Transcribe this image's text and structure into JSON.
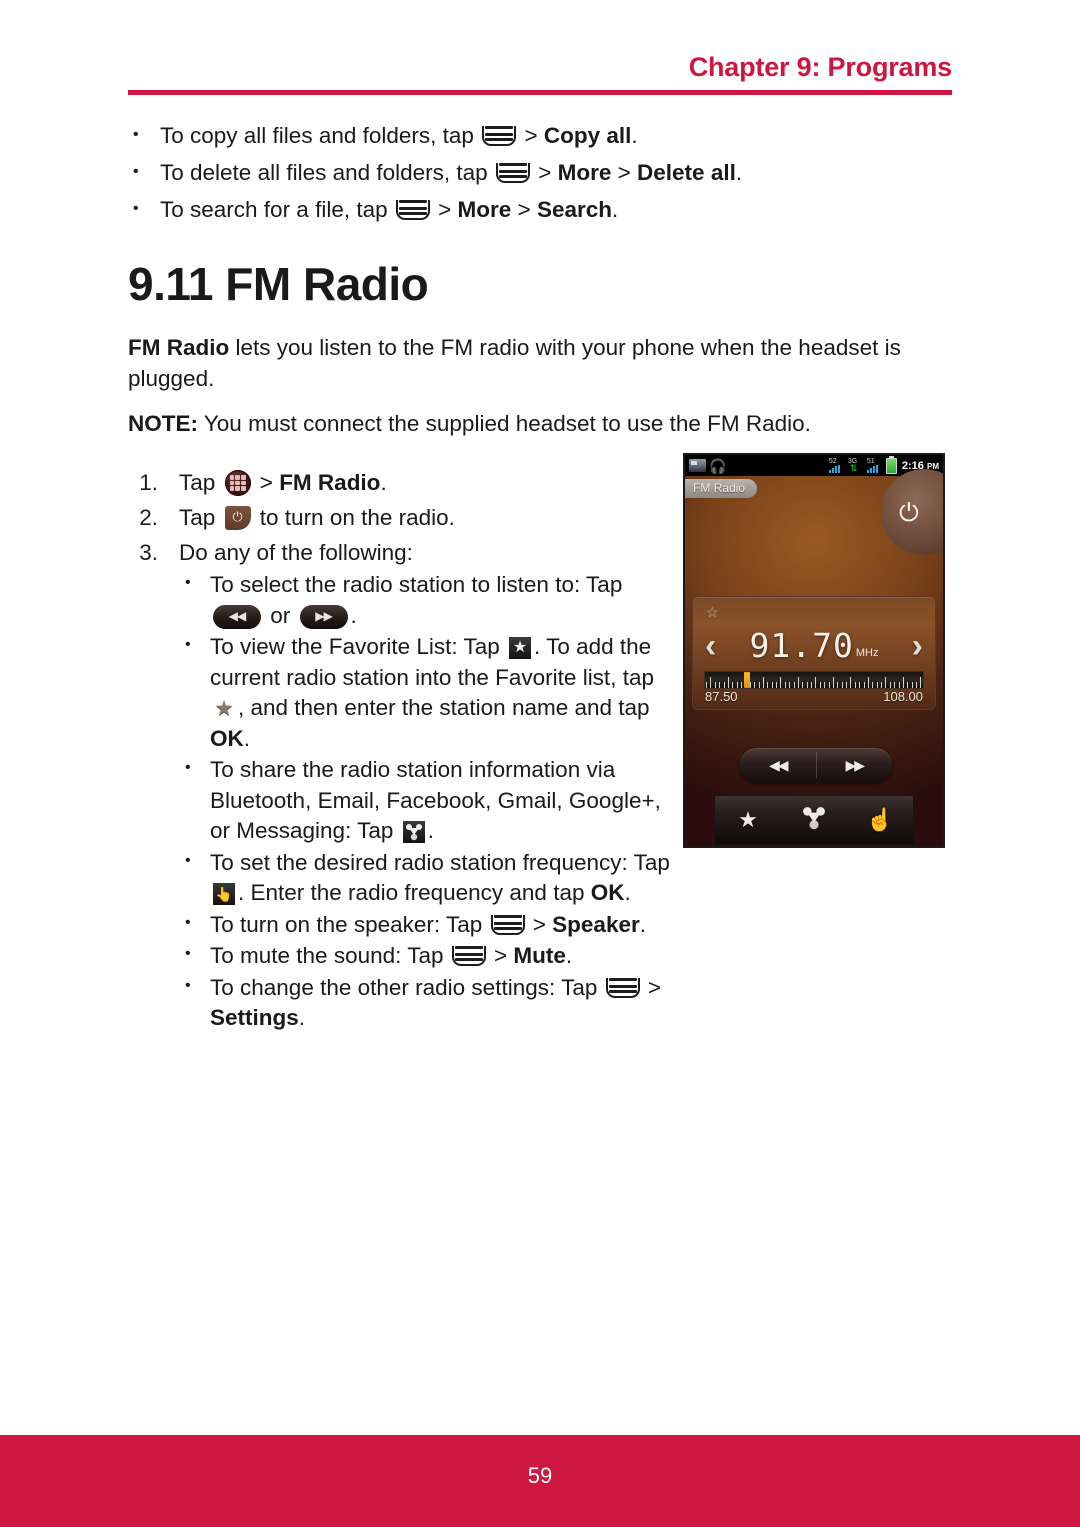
{
  "header": {
    "chapter": "Chapter 9: Programs"
  },
  "top_list": [
    {
      "pre": "To copy all files and folders, tap ",
      "icon": "menu-icon",
      "sep1": " > ",
      "bold1": "Copy all",
      "post": "."
    },
    {
      "pre": "To delete all files and folders, tap ",
      "icon": "menu-icon",
      "sep1": " > ",
      "bold1": "More",
      "sep2": " > ",
      "bold2": "Delete all",
      "post": "."
    },
    {
      "pre": "To search for a file, tap ",
      "icon": "menu-icon",
      "sep1": " > ",
      "bold1": "More",
      "sep2": " > ",
      "bold2": "Search",
      "post": "."
    }
  ],
  "section": {
    "title": "9.11 FM Radio",
    "intro_bold": "FM Radio",
    "intro_rest": " lets you listen to the FM radio with your phone when the headset is plugged.",
    "note_label": "NOTE:",
    "note_rest": " You must connect the supplied headset to use the FM Radio."
  },
  "steps": {
    "step1": {
      "pre": "Tap ",
      "icon": "app-drawer-icon",
      "mid": " > ",
      "bold": "FM Radio",
      "post": "."
    },
    "step2": {
      "pre": "Tap ",
      "icon": "power-icon",
      "post": " to turn on the radio."
    },
    "step3": {
      "text": "Do any of the following:"
    }
  },
  "sub_bullets": {
    "select_station": {
      "pre": "To select the radio station to listen to: Tap ",
      "icon1": "rewind-pill-icon",
      "mid": " or ",
      "icon2": "fast-forward-pill-icon",
      "post": "."
    },
    "favorite": {
      "pre": "To view the Favorite List: Tap ",
      "icon1": "favorite-list-icon",
      "mid": ". To add the current radio station into the Favorite list, tap ",
      "icon2": "add-favorite-star-icon",
      "mid2": ", and then enter the station name and tap ",
      "bold": "OK",
      "post": "."
    },
    "share": {
      "pre": "To share the radio station information via Bluetooth, Email, Facebook, Gmail, Google+, or Messaging: Tap ",
      "icon1": "share-icon",
      "post": "."
    },
    "set_frequency": {
      "pre": "To set the desired radio station frequency: Tap ",
      "icon1": "hand-tune-icon",
      "mid": ". Enter the radio frequency and tap ",
      "bold": "OK",
      "post": "."
    },
    "speaker": {
      "pre": "To turn on the speaker: Tap ",
      "icon1": "menu-icon",
      "mid": " > ",
      "bold": "Speaker",
      "post": "."
    },
    "mute": {
      "pre": "To mute the sound: Tap ",
      "icon1": "menu-icon",
      "mid": " > ",
      "bold": "Mute",
      "post": "."
    },
    "settings": {
      "pre": "To change the other radio settings: Tap ",
      "icon1": "menu-icon",
      "mid": " > ",
      "bold": "Settings",
      "post": "."
    }
  },
  "phone": {
    "statusbar": {
      "radio_icon": "fm-radio-status-icon",
      "headset_icon": "headset-icon",
      "signal1_label": "52",
      "signal2_label": "51",
      "network_label": "3G",
      "network_arrows": "⇅",
      "battery_icon": "battery-icon",
      "clock": "2:16",
      "clock_ampm": "PM"
    },
    "app_label": "FM Radio",
    "power_glyph": "⏻",
    "tuner": {
      "fav_star": "☆",
      "prev_arrow": "‹",
      "frequency": "91.70",
      "unit": "MHz",
      "next_arrow": "›",
      "scale_min": "87.50",
      "scale_max": "108.00",
      "marker_position_percent": 18
    },
    "seek": {
      "rewind": "◀◀",
      "forward": "▶▶"
    },
    "bottom_bar": {
      "favorite": "★",
      "share": "share-icon",
      "tune": "☝"
    }
  },
  "footer": {
    "page_number": "59"
  },
  "colors": {
    "brand_red": "#CD1741",
    "text": "#1a1a1a"
  }
}
